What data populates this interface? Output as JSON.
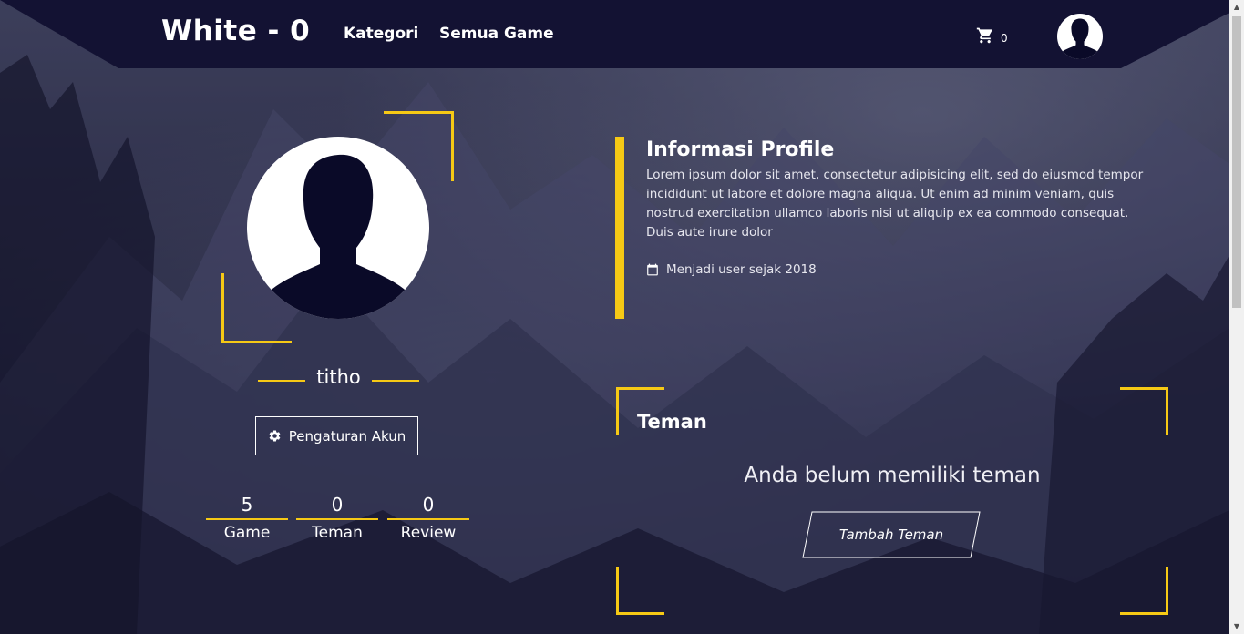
{
  "header": {
    "brand": "White - 0",
    "nav": [
      "Kategori",
      "Semua Game"
    ],
    "cart_count": "0",
    "cart_icon": "cart-icon",
    "avatar_icon": "user-avatar-icon"
  },
  "profile": {
    "username": "titho",
    "settings_label": "Pengaturan Akun",
    "settings_icon": "gear-icon",
    "stats": [
      {
        "value": "5",
        "label": "Game"
      },
      {
        "value": "0",
        "label": "Teman"
      },
      {
        "value": "0",
        "label": "Review"
      }
    ]
  },
  "info": {
    "title": "Informasi Profile",
    "text": "Lorem ipsum dolor sit amet, consectetur adipisicing elit, sed do eiusmod tempor incididunt ut labore et dolore magna aliqua. Ut enim ad minim veniam, quis nostrud exercitation ullamco laboris nisi ut aliquip ex ea commodo consequat. Duis aute irure dolor",
    "joined": "Menjadi user sejak 2018",
    "calendar_icon": "calendar-icon"
  },
  "friends": {
    "title": "Teman",
    "empty": "Anda belum memiliki teman",
    "add_label": "Tambah Teman"
  },
  "colors": {
    "accent": "#f6c915",
    "header_bg": "#131233",
    "avatar_fill": "#0a0a28"
  }
}
